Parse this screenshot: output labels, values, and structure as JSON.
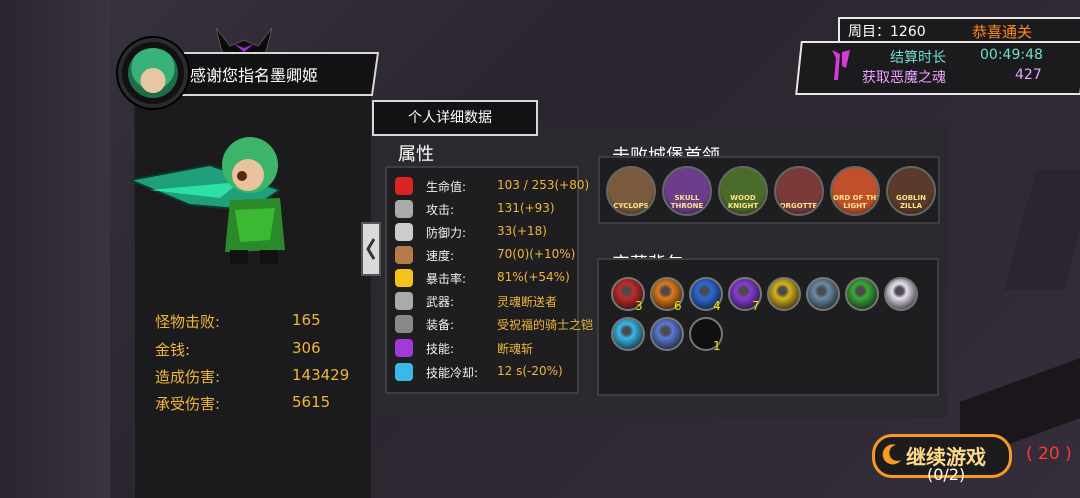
{
  "character": {
    "message": "感谢您指名墨卿姬"
  },
  "summary": [
    {
      "label": "怪物击败:",
      "value": "165"
    },
    {
      "label": "金钱:",
      "value": "306"
    },
    {
      "label": "造成伤害:",
      "value": "143429"
    },
    {
      "label": "承受伤害:",
      "value": "5615"
    }
  ],
  "details_tab": "个人详细数据",
  "attributes": {
    "title": "属性",
    "rows": [
      {
        "icon": "heart-icon",
        "label": "生命值:",
        "value": "103 / 253(+80)"
      },
      {
        "icon": "sword-icon",
        "label": "攻击:",
        "value": "131(+93)"
      },
      {
        "icon": "shield-icon",
        "label": "防御力:",
        "value": "33(+18)"
      },
      {
        "icon": "boot-icon",
        "label": "速度:",
        "value": "70(0)(+10%)"
      },
      {
        "icon": "sun-icon",
        "label": "暴击率:",
        "value": "81%(+54%)"
      },
      {
        "icon": "weapon-icon",
        "label": "武器:",
        "value": "灵魂断送者"
      },
      {
        "icon": "armor-icon",
        "label": "装备:",
        "value": "受祝福的骑士之铠"
      },
      {
        "icon": "skill-icon",
        "label": "技能:",
        "value": "断魂斩"
      },
      {
        "icon": "cooldown-icon",
        "label": "技能冷却:",
        "value": "12 s(-20%)"
      }
    ]
  },
  "bosses": {
    "title": "击败城堡首领",
    "items": [
      {
        "label": "CYCLOPS",
        "color": "#7a5a3c"
      },
      {
        "label": "SKULL THRONE",
        "color": "#6b3d8a"
      },
      {
        "label": "WOOD KNIGHT",
        "color": "#4a6b2a"
      },
      {
        "label": "FORGOTTEN",
        "color": "#7a3a3a"
      },
      {
        "label": "LORD OF THE LIGHT",
        "color": "#c0502a"
      },
      {
        "label": "GOBLIN ZILLA",
        "color": "#5a3a2a"
      }
    ]
  },
  "treasure": {
    "title": "宝藏背包",
    "items": [
      {
        "icon": "red-heart-gem-icon",
        "color": "#c22a2a",
        "count": "3"
      },
      {
        "icon": "fire-gem-icon",
        "color": "#e07a1a",
        "count": "6"
      },
      {
        "icon": "blue-crystal-icon",
        "color": "#2a6ad8",
        "count": "4"
      },
      {
        "icon": "purple-crystal-icon",
        "color": "#8a3ad8",
        "count": "7"
      },
      {
        "icon": "gold-ring-icon",
        "color": "#d8b21a",
        "count": ""
      },
      {
        "icon": "potion-bottle-icon",
        "color": "#6a8aa8",
        "count": ""
      },
      {
        "icon": "green-flask-icon",
        "color": "#3aa83a",
        "count": ""
      },
      {
        "icon": "white-orb-icon",
        "color": "#e8e0f0",
        "count": ""
      },
      {
        "icon": "snowflake-icon",
        "color": "#3ab8e8",
        "count": ""
      },
      {
        "icon": "water-jar-icon",
        "color": "#5a7ad8",
        "count": ""
      },
      {
        "icon": "empty-slot-icon",
        "color": "#101012",
        "count": "1"
      }
    ]
  },
  "run": {
    "cycle_label": "周目：1260",
    "clear_label": "恭喜通关",
    "time_label": "结算时长",
    "time_value": "00:49:48",
    "soul_label": "获取恶魔之魂",
    "soul_value": "427"
  },
  "continue": {
    "label": "继续游戏",
    "count": "( 20 )",
    "progress": "(0/2)"
  }
}
